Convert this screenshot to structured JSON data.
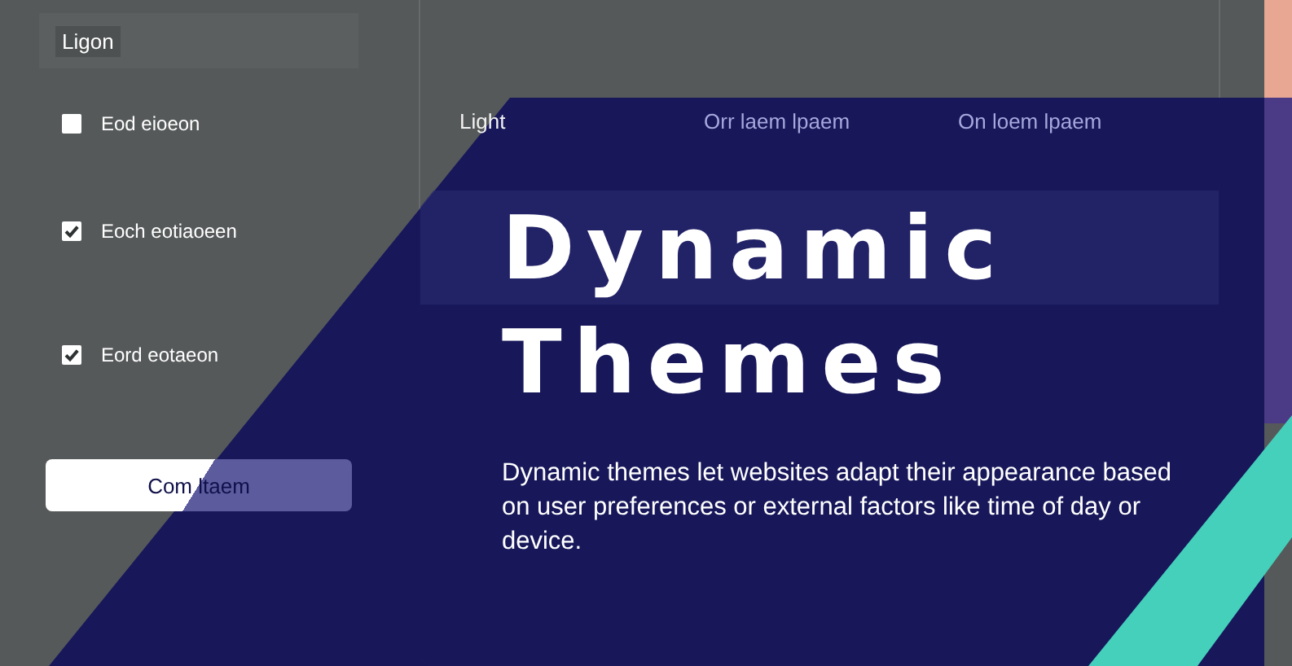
{
  "sidebar": {
    "title": "Ligon",
    "options": [
      {
        "label": "Eod eioeon",
        "checked": false
      },
      {
        "label": "Eoch eotiaoeen",
        "checked": true
      },
      {
        "label": "Eord eotaeon",
        "checked": true
      }
    ],
    "button": "Com ltaem"
  },
  "panel": {
    "header": [
      "Light",
      "Orr laem lpaem",
      "On loem lpaem"
    ]
  },
  "hero": {
    "title": "Dynamic Themes",
    "text": "Dynamic themes let websites adapt their appearance based on user preferences or external factors like time of day or device."
  }
}
